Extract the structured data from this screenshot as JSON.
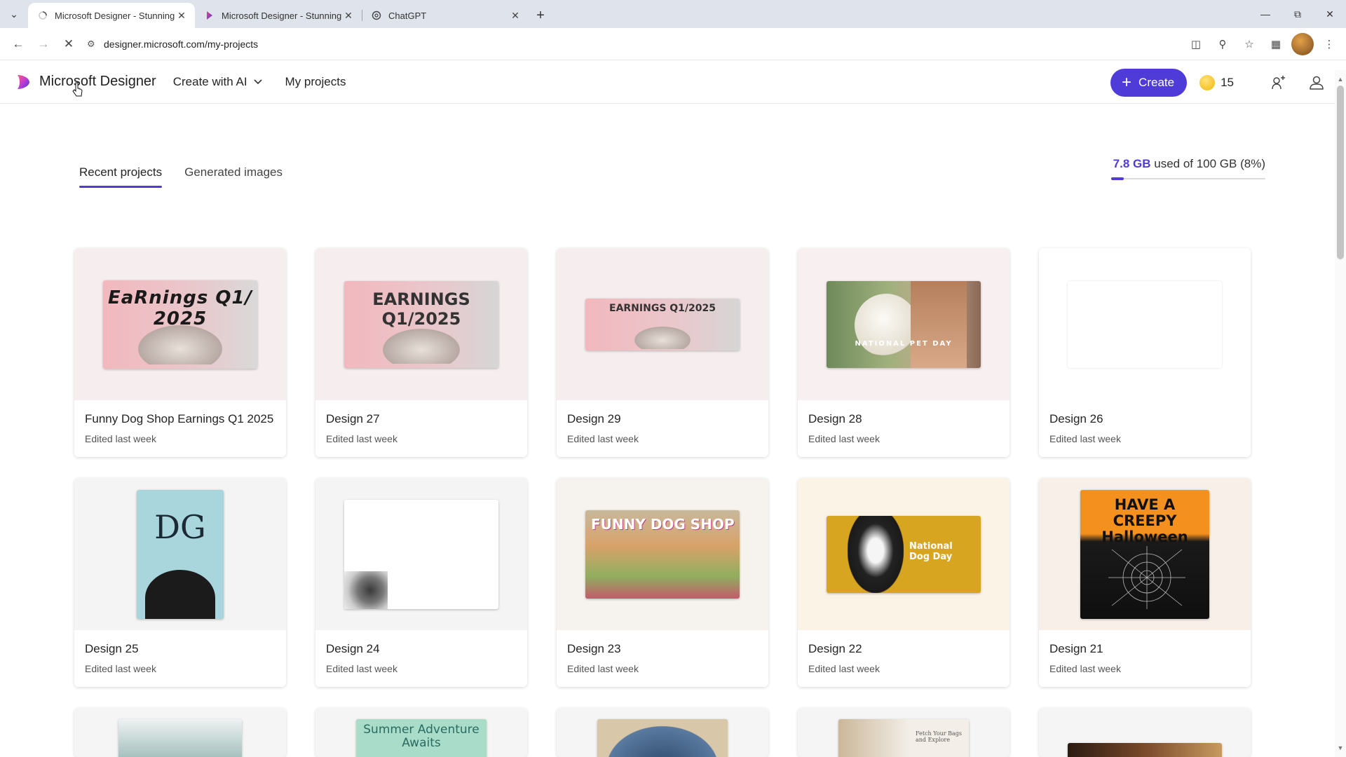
{
  "browser": {
    "tabs": [
      {
        "title": "Microsoft Designer - Stunning",
        "active": true
      },
      {
        "title": "Microsoft Designer - Stunning",
        "active": false
      },
      {
        "title": "ChatGPT",
        "active": false
      }
    ],
    "url": "designer.microsoft.com/my-projects"
  },
  "header": {
    "brand": "Microsoft Designer",
    "nav": {
      "create_with_ai": "Create with AI",
      "my_projects": "My projects"
    },
    "create_label": "Create",
    "credits": "15"
  },
  "tabs": {
    "recent": "Recent projects",
    "generated": "Generated images"
  },
  "storage": {
    "used": "7.8 GB",
    "rest": "used of 100 GB (8%)",
    "percent": 8
  },
  "projects": [
    {
      "title": "Funny Dog Shop Earnings Q1 2025",
      "subtitle": "Edited last week",
      "thumb_text": "EaRnings Q1/ 2025"
    },
    {
      "title": "Design 27",
      "subtitle": "Edited last week",
      "thumb_text": "EARNINGS Q1/2025"
    },
    {
      "title": "Design 29",
      "subtitle": "Edited last week",
      "thumb_text": "EARNINGS Q1/2025"
    },
    {
      "title": "Design 28",
      "subtitle": "Edited last week",
      "thumb_text": "NATIONAL PET DAY"
    },
    {
      "title": "Design 26",
      "subtitle": "Edited last week",
      "thumb_text": ""
    },
    {
      "title": "Design 25",
      "subtitle": "Edited last week",
      "thumb_text": "DG"
    },
    {
      "title": "Design 24",
      "subtitle": "Edited last week",
      "thumb_text": ""
    },
    {
      "title": "Design 23",
      "subtitle": "Edited last week",
      "thumb_text": "FUNNY DOG SHOP"
    },
    {
      "title": "Design 22",
      "subtitle": "Edited last week",
      "thumb_text": "National Dog Day"
    },
    {
      "title": "Design 21",
      "subtitle": "Edited last week",
      "thumb_text": "HAVE A CREEPY Halloween"
    }
  ],
  "partial_row": [
    {
      "thumb_text": ""
    },
    {
      "thumb_text": "Summer Adventure Awaits"
    },
    {
      "thumb_text": ""
    },
    {
      "thumb_text": "Fetch Your Bags and Explore"
    },
    {
      "thumb_text": ""
    }
  ],
  "colors": {
    "accent": "#4f3bd8",
    "coin": "#f2b705"
  }
}
